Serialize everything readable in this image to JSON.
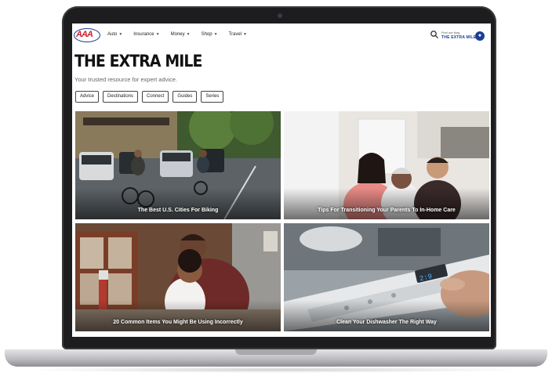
{
  "header": {
    "logo": "AAA",
    "nav": [
      {
        "label": "Auto"
      },
      {
        "label": "Insurance"
      },
      {
        "label": "Money"
      },
      {
        "label": "Shop"
      },
      {
        "label": "Travel"
      }
    ],
    "blog_prompt": "Find our blog",
    "blog_name": "THE EXTRA MILE"
  },
  "page": {
    "title": "THE EXTRA MILE",
    "subtitle": "Your trusted resource for expert advice."
  },
  "filters": [
    "Advice",
    "Destinations",
    "Connect",
    "Guides",
    "Series"
  ],
  "cards": [
    {
      "caption": "The Best U.S. Cities For Biking"
    },
    {
      "caption": "Tips For Transitioning Your Parents To In-Home Care"
    },
    {
      "caption": "20 Common Items You Might Be Using Incorrectly"
    },
    {
      "caption": "Clean Your Dishwasher The Right Way"
    }
  ],
  "colors": {
    "brand_blue": "#1c3f94",
    "brand_red": "#d2202f",
    "laptop_bezel": "#1d1d1f"
  }
}
